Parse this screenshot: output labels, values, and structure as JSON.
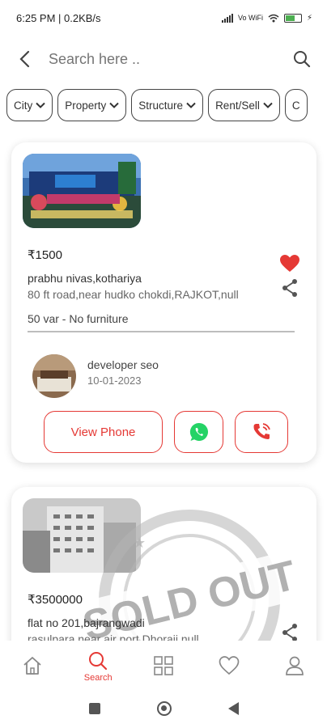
{
  "status_bar": {
    "time_text": "6:25 PM | 0.2KB/s",
    "network_text": "Vo WiFi",
    "battery_level": 0.6
  },
  "search": {
    "placeholder": "Search here .."
  },
  "filters": [
    {
      "label": "City"
    },
    {
      "label": "Property"
    },
    {
      "label": "Structure"
    },
    {
      "label": "Rent/Sell"
    },
    {
      "label": "C"
    }
  ],
  "listings": [
    {
      "price": "₹1500",
      "title": "prabhu nivas,kothariya",
      "address": "80 ft road,near hudko chokdi,RAJKOT,null",
      "details": "50 var - No furniture",
      "favorited": true,
      "developer_name": "developer seo",
      "developer_date": "10-01-2023",
      "view_phone_label": "View Phone",
      "sold": false
    },
    {
      "price": "₹3500000",
      "title": "flat no 201,bajrangwadi",
      "address": "rasulpara,near air port,Dhoraji,null",
      "favorited": false,
      "sold": true,
      "stamp_text": "SOLD OUT"
    }
  ],
  "bottom_nav": {
    "items": [
      {
        "icon": "home-icon",
        "label": ""
      },
      {
        "icon": "search-icon",
        "label": "Search"
      },
      {
        "icon": "grid-icon",
        "label": ""
      },
      {
        "icon": "heart-icon",
        "label": ""
      },
      {
        "icon": "user-icon",
        "label": ""
      }
    ],
    "active_index": 1
  },
  "colors": {
    "accent": "#e53935",
    "whatsapp": "#25d366",
    "text": "#333333"
  }
}
